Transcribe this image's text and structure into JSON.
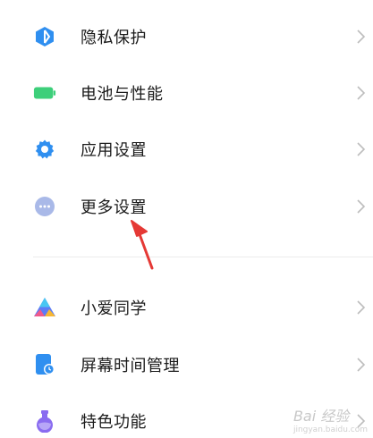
{
  "settings_list": {
    "items": [
      {
        "label": "隐私保护",
        "icon": "privacy-shield-icon",
        "color": "#2f8ff0"
      },
      {
        "label": "电池与性能",
        "icon": "battery-icon",
        "color": "#3dcf7a"
      },
      {
        "label": "应用设置",
        "icon": "gear-icon",
        "color": "#2f8ff0"
      },
      {
        "label": "更多设置",
        "icon": "more-dots-icon",
        "color": "#a9b9e8"
      },
      {
        "label": "小爱同学",
        "icon": "xiaoai-icon",
        "color": "#5d7cf6"
      },
      {
        "label": "屏幕时间管理",
        "icon": "screen-time-icon",
        "color": "#2f8ff0"
      },
      {
        "label": "特色功能",
        "icon": "feature-flask-icon",
        "color": "#8a6cf0"
      }
    ]
  },
  "annotation": {
    "arrow_color": "#e53935"
  },
  "watermark": {
    "text": "Bai 经验",
    "sub": "jingyan.baidu.com"
  }
}
